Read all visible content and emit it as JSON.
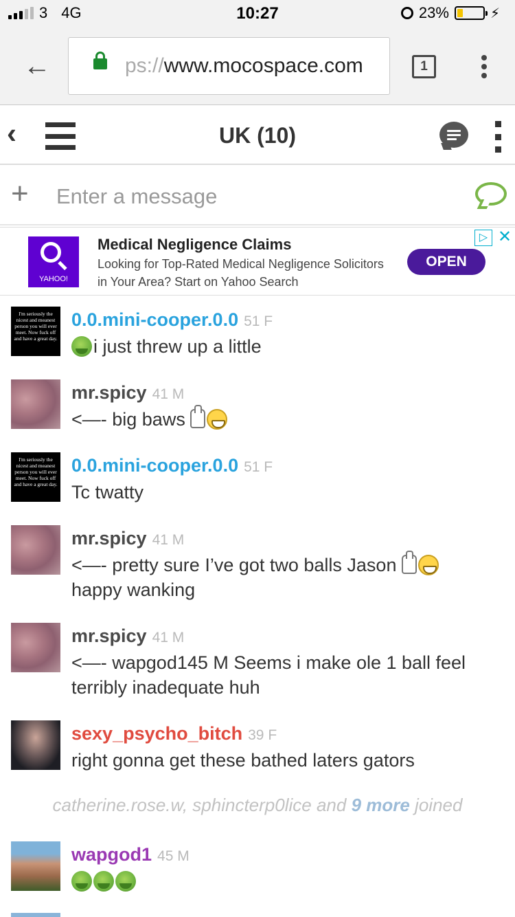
{
  "status_bar": {
    "carrier": "3",
    "network": "4G",
    "time": "10:27",
    "battery": "23%",
    "battery_level": 0.23
  },
  "browser": {
    "url_faded": "ps://",
    "url_main": "www.mocospace.com",
    "tab_count": "1"
  },
  "app_header": {
    "title": "UK (10)"
  },
  "composer": {
    "placeholder": "Enter a message"
  },
  "ad": {
    "brand": "YAHOO!",
    "title": "Medical Negligence Claims",
    "description": "Looking for Top-Rated Medical Negligence Solicitors in Your Area? Start on Yahoo Search",
    "cta": "OPEN",
    "avatar_text": ""
  },
  "avatar_caption": "I'm seriously the nicest and meanest person you will ever meet. Now fuck off and have a great day.",
  "messages": [
    {
      "user": "0.0.mini-cooper.0.0",
      "meta": "51 F",
      "text": "i just threw up a little",
      "color": "#2aa3de"
    },
    {
      "user": "mr.spicy",
      "meta": "41 M",
      "text": "<—- big baws",
      "color": "#4a4a4a"
    },
    {
      "user": "0.0.mini-cooper.0.0",
      "meta": "51 F",
      "text": "Tc twatty",
      "color": "#2aa3de"
    },
    {
      "user": "mr.spicy",
      "meta": "41 M",
      "text": "<—- pretty sure I’ve got two balls Jason",
      "text2": "happy wanking",
      "color": "#4a4a4a"
    },
    {
      "user": "mr.spicy",
      "meta": "41 M",
      "text": "<—- wapgod145 M Seems i make ole 1 ball feel terribly inadequate huh",
      "color": "#4a4a4a"
    },
    {
      "user": "sexy_psycho_bitch",
      "meta": "39 F",
      "text": "right gonna get these bathed laters gators",
      "color": "#e04b3f"
    },
    {
      "user": "wapgod1",
      "meta": "45 M",
      "text": "",
      "color": "#9a39b3"
    }
  ],
  "joined": {
    "prefix": "catherine.rose.w, sphincterp0lice and ",
    "count": "9 more",
    "suffix": " joined"
  }
}
